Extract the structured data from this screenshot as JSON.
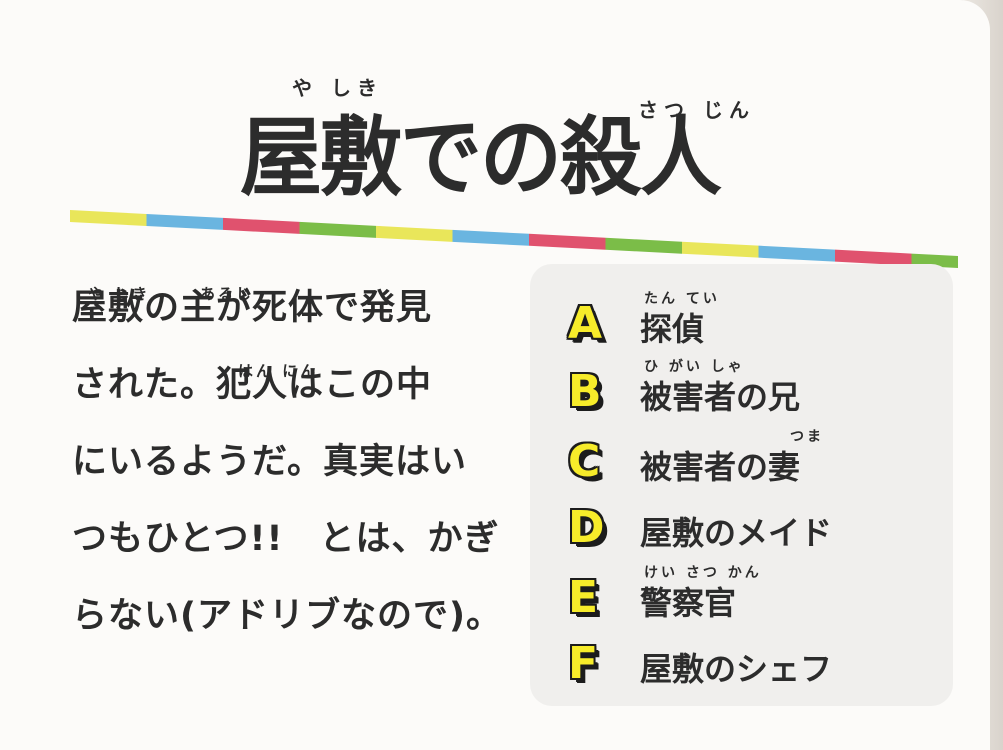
{
  "title": {
    "text": "屋敷での殺人",
    "ruby_yashiki": "や しき",
    "ruby_satsujin": "さつ じん"
  },
  "stripe_colors": [
    "#e9e65a",
    "#6ab5e0",
    "#e0526e",
    "#7bbd48"
  ],
  "body": {
    "lines": [
      "屋敷の主が死体で発見",
      "された。犯人はこの中",
      "にいるようだ。真実はい",
      "つもひとつ!!　とは、かぎ",
      "らない(アドリブなので)。"
    ],
    "ruby_yashiki": "や しき",
    "ruby_aruji": "あるじ",
    "ruby_hannin": "はん にん"
  },
  "suspects": [
    {
      "letter": "A",
      "name": "探偵",
      "ruby": "たん てい"
    },
    {
      "letter": "B",
      "name": "被害者の兄",
      "ruby": "ひ がい しゃ"
    },
    {
      "letter": "C",
      "name": "被害者の妻",
      "ruby": "つま"
    },
    {
      "letter": "D",
      "name": "屋敷のメイド",
      "ruby": ""
    },
    {
      "letter": "E",
      "name": "警察官",
      "ruby": "けい さつ かん"
    },
    {
      "letter": "F",
      "name": "屋敷のシェフ",
      "ruby": ""
    }
  ]
}
